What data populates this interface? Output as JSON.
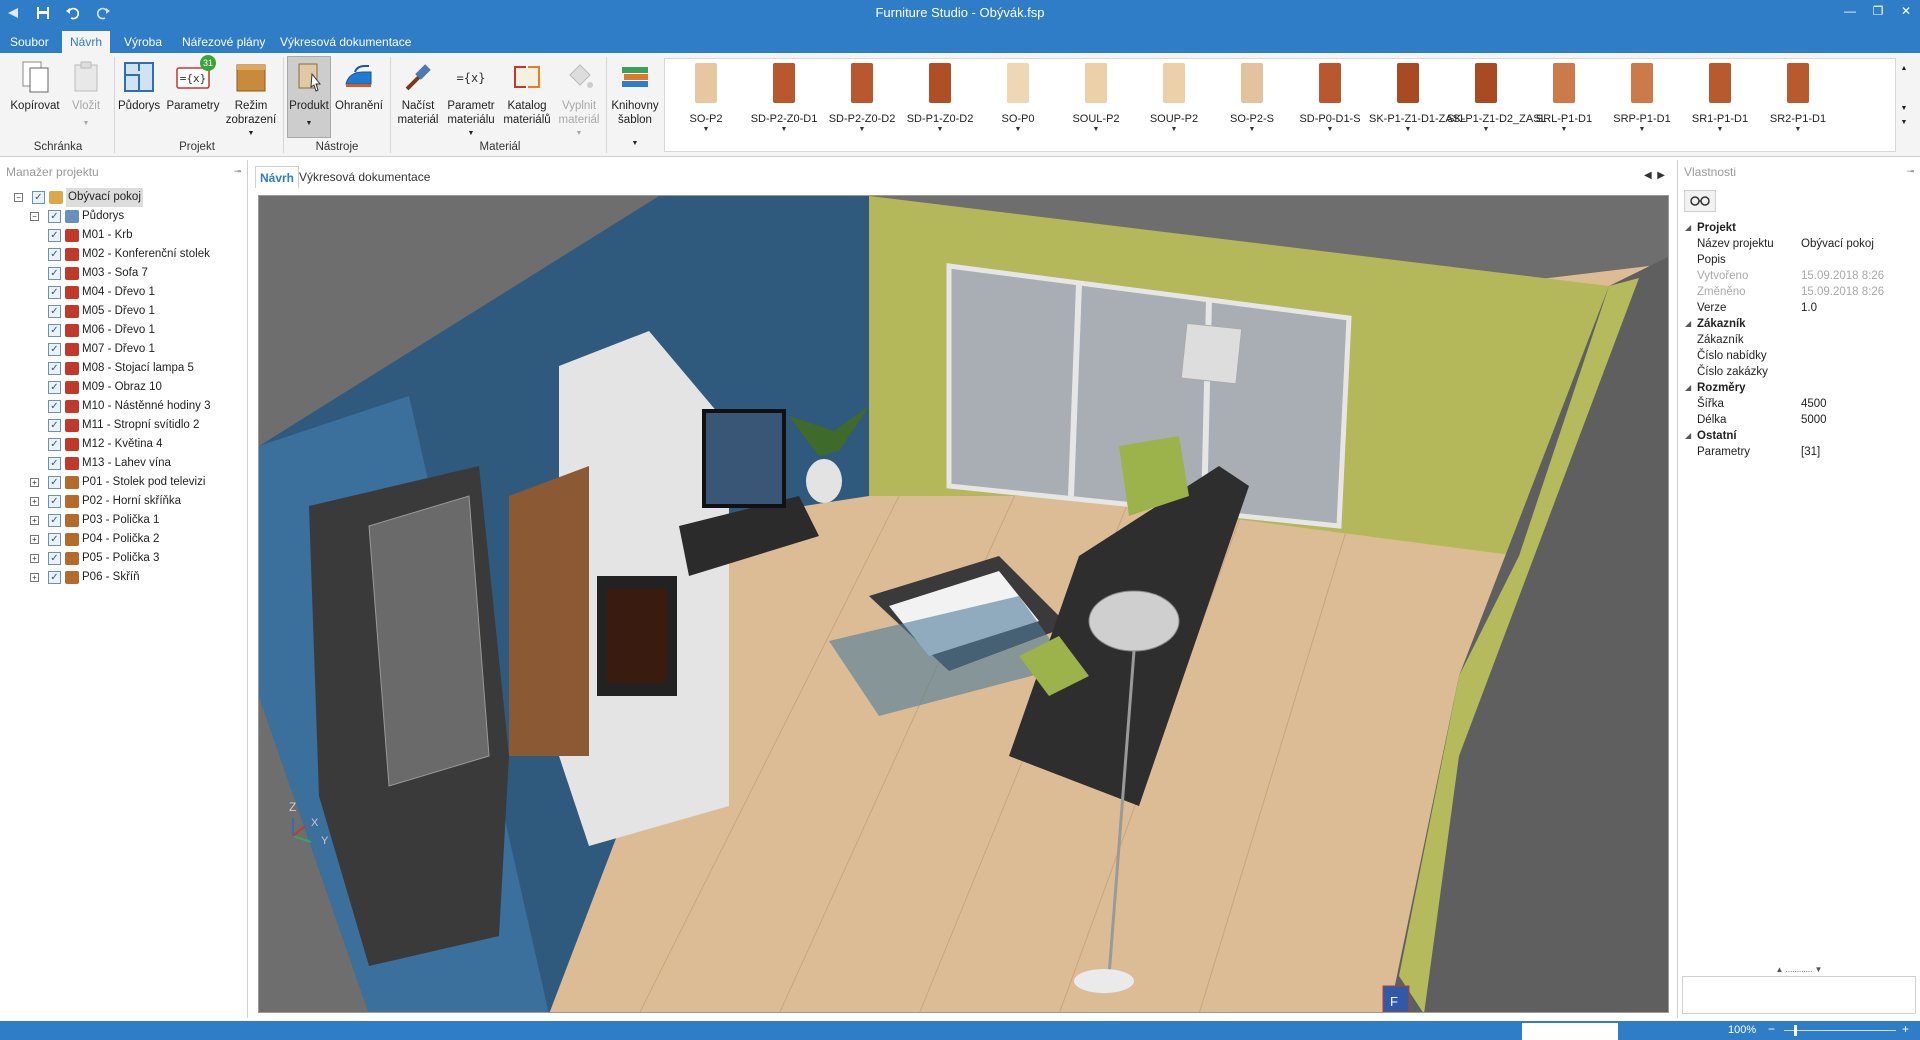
{
  "window": {
    "title": "Furniture Studio - Obývák.fsp"
  },
  "menu": {
    "tabs": [
      {
        "label": "Soubor"
      },
      {
        "label": "Návrh"
      },
      {
        "label": "Výroba"
      },
      {
        "label": "Nářezové plány"
      },
      {
        "label": "Výkresová dokumentace"
      }
    ],
    "active": "Návrh"
  },
  "ribbon": {
    "kopirovat": "Kopírovat",
    "vlozit": "Vložit",
    "schranka": "Schránka",
    "pudorys": "Půdorys",
    "parametry": "Parametry",
    "parametry_badge": "31",
    "rezim_1": "Režim",
    "rezim_2": "zobrazení",
    "projekt": "Projekt",
    "produkt": "Produkt",
    "ohraneni": "Ohranění",
    "nastroje": "Nástroje",
    "nacist_1": "Načíst",
    "nacist_2": "materiál",
    "parametr_1": "Parametr",
    "parametr_2": "materiálu",
    "katalog_1": "Katalog",
    "katalog_2": "materiálů",
    "vyplnit_1": "Vyplnit",
    "vyplnit_2": "materiál",
    "material": "Materiál",
    "knihovny_1": "Knihovny",
    "knihovny_2": "šablon",
    "gallery": [
      {
        "label": "SO-P2",
        "color": "#e7c7a0"
      },
      {
        "label": "SD-P2-Z0-D1",
        "color": "#b9582e"
      },
      {
        "label": "SD-P2-Z0-D2",
        "color": "#b9582e"
      },
      {
        "label": "SD-P1-Z0-D2",
        "color": "#b04e26"
      },
      {
        "label": "SO-P0",
        "color": "#efd7b6"
      },
      {
        "label": "SOUL-P2",
        "color": "#ecd0aa"
      },
      {
        "label": "SOUP-P2",
        "color": "#ecd0aa"
      },
      {
        "label": "SO-P2-S",
        "color": "#e3c39d"
      },
      {
        "label": "SD-P0-D1-S",
        "color": "#b9582e"
      },
      {
        "label": "SK-P1-Z1-D1-ZASL",
        "color": "#a84a22"
      },
      {
        "label": "SK-P1-Z1-D2_ZASL",
        "color": "#a84a22"
      },
      {
        "label": "SRL-P1-D1",
        "color": "#cc7a4a"
      },
      {
        "label": "SRP-P1-D1",
        "color": "#cc7a4a"
      },
      {
        "label": "SR1-P1-D1",
        "color": "#b75a2d"
      },
      {
        "label": "SR2-P1-D1",
        "color": "#b75a2d"
      }
    ]
  },
  "leftpanel": {
    "title": "Manažer projektu",
    "tree": [
      {
        "label": "Obývací pokoj",
        "level": 0,
        "icon": "room-icon",
        "selected": true
      },
      {
        "label": "Půdorys",
        "level": 1,
        "icon": "floorplan-icon"
      },
      {
        "label": "M01 - Krb",
        "level": 2,
        "icon": "model-icon"
      },
      {
        "label": "M02 - Konferenční stolek",
        "level": 2,
        "icon": "model-icon"
      },
      {
        "label": "M03 - Sofa 7",
        "level": 2,
        "icon": "model-icon"
      },
      {
        "label": "M04 - Dřevo 1",
        "level": 2,
        "icon": "model-icon"
      },
      {
        "label": "M05 - Dřevo 1",
        "level": 2,
        "icon": "model-icon"
      },
      {
        "label": "M06 - Dřevo 1",
        "level": 2,
        "icon": "model-icon"
      },
      {
        "label": "M07 - Dřevo 1",
        "level": 2,
        "icon": "model-icon"
      },
      {
        "label": "M08 - Stojací lampa 5",
        "level": 2,
        "icon": "model-icon"
      },
      {
        "label": "M09 - Obraz 10",
        "level": 2,
        "icon": "model-icon"
      },
      {
        "label": "M10 - Nástěnné hodiny 3",
        "level": 2,
        "icon": "model-icon"
      },
      {
        "label": "M11 - Stropní svítidlo 2",
        "level": 2,
        "icon": "model-icon"
      },
      {
        "label": "M12 - Květina 4",
        "level": 2,
        "icon": "model-icon"
      },
      {
        "label": "M13 - Lahev vína",
        "level": 2,
        "icon": "model-icon"
      },
      {
        "label": "P01 - Stolek pod televizi",
        "level": 1,
        "icon": "product-icon",
        "expandable": true
      },
      {
        "label": "P02 - Horní skříňka",
        "level": 1,
        "icon": "product-icon",
        "expandable": true
      },
      {
        "label": "P03 - Polička 1",
        "level": 1,
        "icon": "product-icon",
        "expandable": true
      },
      {
        "label": "P04 - Polička 2",
        "level": 1,
        "icon": "product-icon",
        "expandable": true
      },
      {
        "label": "P05 - Polička 3",
        "level": 1,
        "icon": "product-icon",
        "expandable": true
      },
      {
        "label": "P06 - Skříň",
        "level": 1,
        "icon": "product-icon",
        "expandable": true
      }
    ]
  },
  "center": {
    "tabs": [
      {
        "label": "Návrh"
      },
      {
        "label": "Výkresová dokumentace"
      }
    ],
    "active": "Návrh",
    "axes": {
      "z": "Z",
      "x": "X",
      "y": "Y"
    },
    "cube": "F"
  },
  "rightpanel": {
    "title": "Vlastnosti",
    "props": [
      {
        "type": "cat",
        "key": "Projekt"
      },
      {
        "key": "Název projektu",
        "value": "Obývací pokoj"
      },
      {
        "key": "Popis",
        "value": ""
      },
      {
        "key": "Vytvořeno",
        "value": "15.09.2018 8:26",
        "grey": true
      },
      {
        "key": "Změněno",
        "value": "15.09.2018 8:26",
        "grey": true
      },
      {
        "key": "Verze",
        "value": "1.0"
      },
      {
        "type": "cat",
        "key": "Zákazník"
      },
      {
        "key": "Zákazník",
        "value": ""
      },
      {
        "key": "Číslo nabídky",
        "value": ""
      },
      {
        "key": "Číslo zakázky",
        "value": ""
      },
      {
        "type": "cat",
        "key": "Rozměry"
      },
      {
        "key": "Šířka",
        "value": "4500"
      },
      {
        "key": "Délka",
        "value": "5000"
      },
      {
        "type": "cat",
        "key": "Ostatní"
      },
      {
        "key": "Parametry",
        "value": "[31]"
      }
    ]
  },
  "status": {
    "zoom": "100%"
  },
  "colors": {
    "accent": "#2f7cc7"
  }
}
